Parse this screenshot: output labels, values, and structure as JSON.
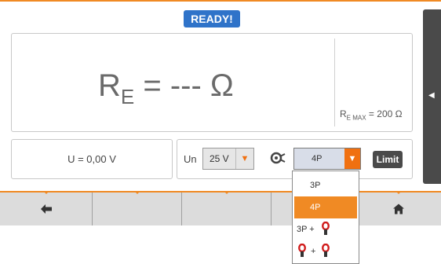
{
  "status": {
    "label": "READY!"
  },
  "measurement": {
    "symbol": "R",
    "subscript": "E",
    "value_text": "= --- Ω",
    "limit_symbol": "R",
    "limit_subscript": "E MAX",
    "limit_value": "= 200 Ω"
  },
  "voltage_reading": "U = 0,00 V",
  "controls": {
    "un_label": "Un",
    "voltage_value": "25 V",
    "method_value": "4P",
    "limit_button": "Limit"
  },
  "method_dropdown": {
    "options": [
      "3P",
      "4P",
      "3P +",
      "+"
    ],
    "selected": "4P"
  },
  "icons": {
    "side_arrow": "left-arrow-icon",
    "back": "back-arrow-icon",
    "home": "home-icon",
    "clamp": "clamp-icon"
  },
  "colors": {
    "accent": "#f08a24",
    "status_bg": "#2f73c9",
    "dark": "#4a4a4a",
    "bar": "#dcdcdc"
  }
}
